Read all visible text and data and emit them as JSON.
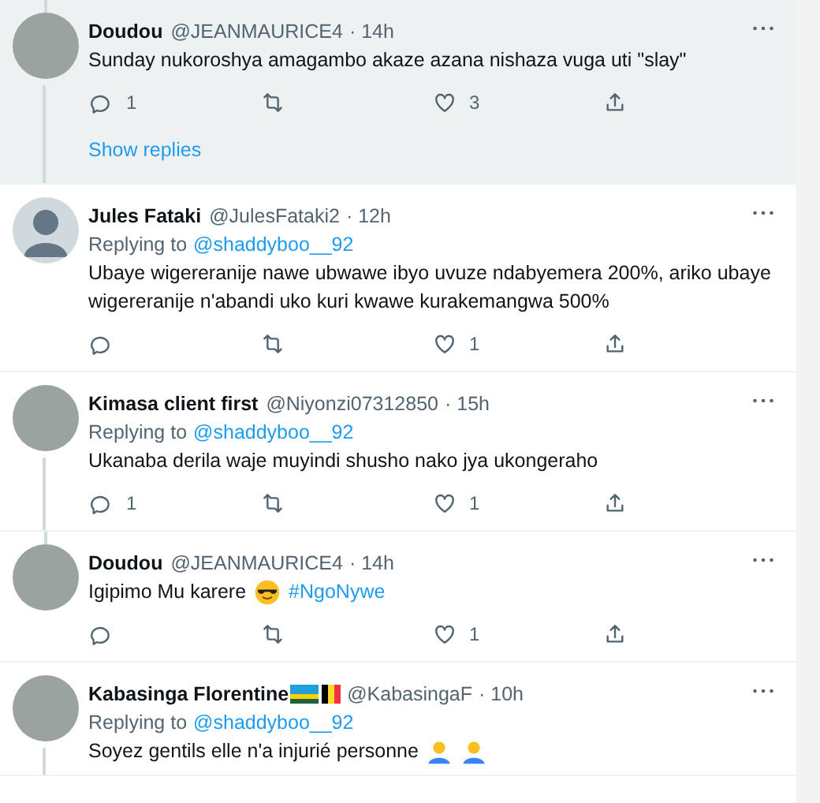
{
  "tweets": [
    {
      "name": "Doudou",
      "flagged": false,
      "handle": "@JEANMAURICE4",
      "time": "· 14h",
      "default_avatar": false,
      "highlighted": true,
      "thread_above": true,
      "thread_below": true,
      "parts": [
        {
          "kind": "text",
          "text": "Sunday nukoroshya amagambo akaze azana nishaza vuga uti \"slay\""
        }
      ],
      "replies": "1",
      "likes": "3",
      "show_replies": "Show replies"
    },
    {
      "name": "Jules Fataki",
      "flagged": false,
      "handle": "@JulesFataki2",
      "time": "· 12h",
      "default_avatar": true,
      "highlighted": false,
      "thread_above": false,
      "thread_below": false,
      "reply_to": {
        "label": "Replying to",
        "user": "@shaddyboo__92"
      },
      "parts": [
        {
          "kind": "text",
          "text": "Ubaye wigereranije nawe ubwawe ibyo uvuze ndabyemera 200%, ariko ubaye wigereranije n'abandi uko kuri kwawe kurakemangwa 500%"
        }
      ],
      "likes": "1"
    },
    {
      "name": "Kimasa client first",
      "flagged": false,
      "handle": "@Niyonzi07312850",
      "time": "· 15h",
      "default_avatar": false,
      "highlighted": false,
      "thread_above": false,
      "thread_below": true,
      "reply_to": {
        "label": "Replying to",
        "user": "@shaddyboo__92"
      },
      "parts": [
        {
          "kind": "text",
          "text": "Ukanaba derila waje muyindi shusho nako jya ukongeraho"
        }
      ],
      "replies": "1",
      "likes": "1"
    },
    {
      "name": "Doudou",
      "flagged": false,
      "handle": "@JEANMAURICE4",
      "time": "· 14h",
      "default_avatar": false,
      "highlighted": false,
      "thread_above": true,
      "thread_below": false,
      "parts": [
        {
          "kind": "text",
          "text": "Igipimo Mu karere"
        },
        {
          "kind": "sunglasses"
        },
        {
          "kind": "hashtag",
          "text": "#NgoNywe"
        }
      ],
      "likes": "1"
    },
    {
      "name": "Kabasinga Florentine",
      "flagged": true,
      "handle": "@KabasingaF",
      "time": "· 10h",
      "default_avatar": false,
      "highlighted": false,
      "thread_above": false,
      "thread_below": true,
      "reply_to": {
        "label": "Replying to",
        "user": "@shaddyboo__92"
      },
      "parts": [
        {
          "kind": "text",
          "text": "Soyez gentils elle n'a injurié personne"
        },
        {
          "kind": "person"
        },
        {
          "kind": "person"
        }
      ]
    }
  ]
}
